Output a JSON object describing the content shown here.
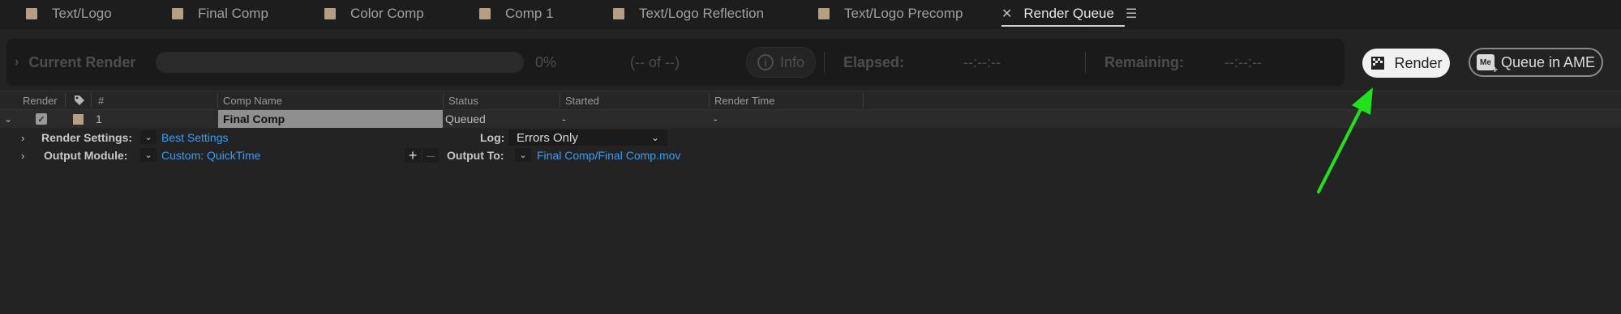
{
  "tabs": [
    {
      "label": "Text/Logo",
      "color": "#b59f83"
    },
    {
      "label": "Final Comp",
      "color": "#b59f83"
    },
    {
      "label": "Color Comp",
      "color": "#b59f83"
    },
    {
      "label": "Comp 1",
      "color": "#b59f83"
    },
    {
      "label": "Text/Logo Reflection",
      "color": "#b59f83"
    },
    {
      "label": "Text/Logo Precomp",
      "color": "#b59f83"
    },
    {
      "label": "Render Queue",
      "active": true
    }
  ],
  "render_bar": {
    "current_render_label": "Current Render",
    "progress": 0,
    "progress_text": "0%",
    "count_text": "(-- of --)",
    "info_label": "Info",
    "elapsed_label": "Elapsed:",
    "elapsed_value": "--:--:--",
    "remaining_label": "Remaining:",
    "remaining_value": "--:--:--",
    "render_button": "Render",
    "queue_ame_button": "Queue in AME",
    "ame_badge": "Me"
  },
  "table": {
    "columns": [
      "Render",
      "#",
      "Comp Name",
      "Status",
      "Started",
      "Render Time"
    ],
    "rows": [
      {
        "number": "1",
        "render_checked": true,
        "comp_name": "Final Comp",
        "status": "Queued",
        "started": "-",
        "render_time": "-",
        "render_settings_label": "Render Settings:",
        "render_settings_value": "Best Settings",
        "log_label": "Log:",
        "log_value": "Errors Only",
        "output_module_label": "Output Module:",
        "output_module_value": "Custom: QuickTime",
        "output_to_label": "Output To:",
        "output_to_value": "Final Comp/Final Comp.mov"
      }
    ]
  },
  "colors": {
    "link": "#3b9cf0",
    "annotation_arrow": "#22e01c",
    "label_swatch": "#b59f83"
  }
}
